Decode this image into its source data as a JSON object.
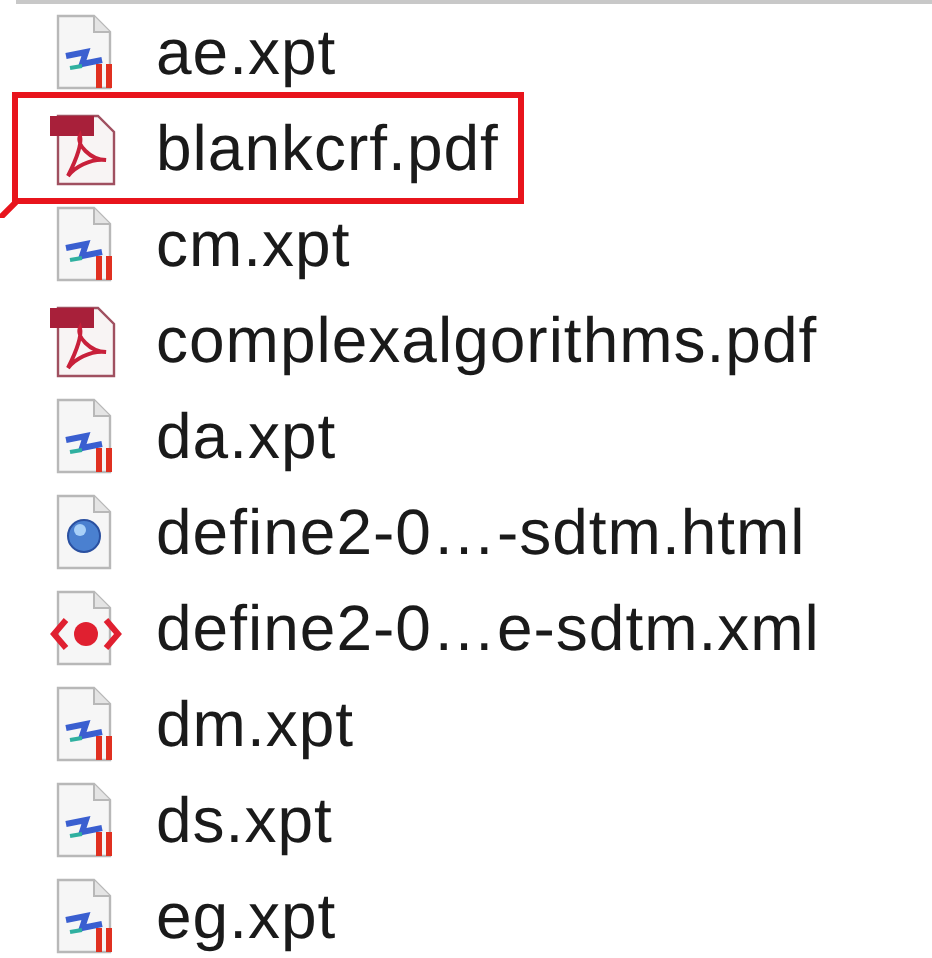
{
  "files": [
    {
      "name": "ae.xpt",
      "kind": "xpt",
      "highlighted": false
    },
    {
      "name": "blankcrf.pdf",
      "kind": "pdf",
      "highlighted": true
    },
    {
      "name": "cm.xpt",
      "kind": "xpt",
      "highlighted": false
    },
    {
      "name": "complexalgorithms.pdf",
      "kind": "pdf",
      "highlighted": false
    },
    {
      "name": "da.xpt",
      "kind": "xpt",
      "highlighted": false
    },
    {
      "name": "define2-0…-sdtm.html",
      "kind": "html",
      "highlighted": false
    },
    {
      "name": "define2-0…e-sdtm.xml",
      "kind": "xml",
      "highlighted": false
    },
    {
      "name": "dm.xpt",
      "kind": "xpt",
      "highlighted": false
    },
    {
      "name": "ds.xpt",
      "kind": "xpt",
      "highlighted": false
    },
    {
      "name": "eg.xpt",
      "kind": "xpt",
      "highlighted": false
    }
  ]
}
